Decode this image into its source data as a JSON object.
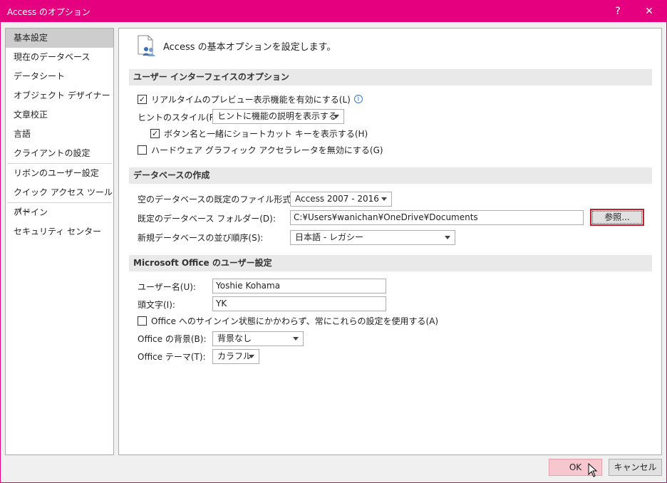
{
  "window": {
    "title": "Access のオプション",
    "help": "?",
    "close": "✕"
  },
  "sidebar": {
    "items": [
      {
        "label": "基本設定",
        "active": true
      },
      {
        "label": "現在のデータベース"
      },
      {
        "label": "データシート"
      },
      {
        "label": "オブジェクト デザイナー"
      },
      {
        "label": "文章校正"
      },
      {
        "label": "言語"
      },
      {
        "label": "クライアントの設定"
      },
      {
        "label": "リボンのユーザー設定"
      },
      {
        "label": "クイック アクセス ツール バー"
      },
      {
        "label": "アドイン"
      },
      {
        "label": "セキュリティ センター"
      }
    ]
  },
  "main": {
    "header": "Access の基本オプションを設定します。",
    "sections": {
      "ui": "ユーザー インターフェイスのオプション",
      "db": "データベースの作成",
      "office": "Microsoft Office のユーザー設定"
    },
    "ui": {
      "realtime_preview": {
        "label": "リアルタイムのプレビュー表示機能を有効にする(L)",
        "checked": true
      },
      "tooltip_style_label": "ヒントのスタイル(R):",
      "tooltip_style_value": "ヒントに機能の説明を表示する",
      "shortcut_keys": {
        "label": "ボタン名と一緒にショートカット キーを表示する(H)",
        "checked": true
      },
      "disable_hw_accel": {
        "label": "ハードウェア グラフィック アクセラレータを無効にする(G)",
        "checked": false
      }
    },
    "db": {
      "format_label": "空のデータベースの既定のファイル形式(F):",
      "format_value": "Access 2007 - 2016",
      "folder_label": "既定のデータベース フォルダー(D):",
      "folder_value": "C:¥Users¥wanichan¥OneDrive¥Documents",
      "browse_label": "参照...",
      "sort_label": "新規データベースの並び順序(S):",
      "sort_value": "日本語 - レガシー"
    },
    "office": {
      "username_label": "ユーザー名(U):",
      "username_value": "Yoshie Kohama",
      "initials_label": "頭文字(I):",
      "initials_value": "YK",
      "always_use": {
        "label": "Office へのサインイン状態にかかわらず、常にこれらの設定を使用する(A)",
        "checked": false
      },
      "background_label": "Office の背景(B):",
      "background_value": "背景なし",
      "theme_label": "Office テーマ(T):",
      "theme_value": "カラフル"
    }
  },
  "footer": {
    "ok": "OK",
    "cancel": "キャンセル"
  },
  "colors": {
    "titlebar": "#e4007f",
    "ok_button": "#f7c7cf",
    "browse_border": "#c3202f"
  }
}
